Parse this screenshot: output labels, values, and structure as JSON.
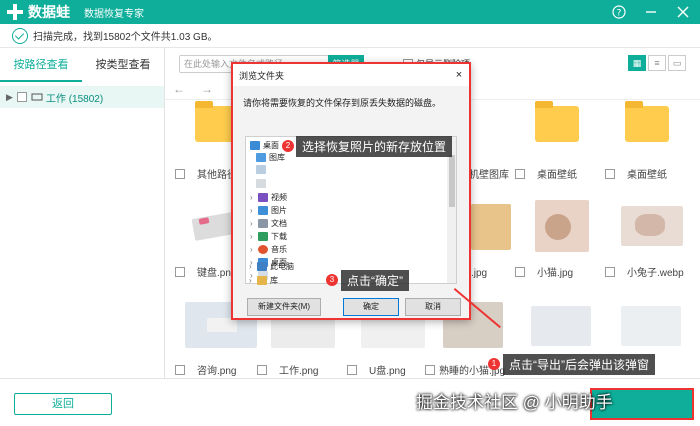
{
  "app": {
    "name": "数据蛙",
    "subtitle": "数据恢复专家"
  },
  "status": {
    "text": "扫描完成，找到15802个文件共1.03 GB。"
  },
  "sidebar": {
    "tabs": [
      {
        "label": "按路径查看"
      },
      {
        "label": "按类型查看"
      }
    ],
    "tree": [
      {
        "label": "工作 (15802)"
      }
    ]
  },
  "toolbar": {
    "search_placeholder": "在此处输入文件名或路径",
    "filter_label": "筛选器",
    "only_deleted_label": "仅显示删除项"
  },
  "files": [
    {
      "name": "其他路径",
      "kind": "folder"
    },
    {
      "name": "",
      "kind": "folder"
    },
    {
      "name": "",
      "kind": "folder"
    },
    {
      "name": "手机壁图库",
      "kind": "folder"
    },
    {
      "name": "桌面壁纸",
      "kind": "folder"
    },
    {
      "name": "桌面壁纸",
      "kind": "folder"
    },
    {
      "name": "键盘.png",
      "kind": "image"
    },
    {
      "name": "",
      "kind": "image"
    },
    {
      "name": "",
      "kind": "image"
    },
    {
      "name": "天.jpg",
      "kind": "image"
    },
    {
      "name": "小猫.jpg",
      "kind": "image"
    },
    {
      "name": "小兔子.webp",
      "kind": "image"
    },
    {
      "name": "咨询.png",
      "kind": "image"
    },
    {
      "name": "工作.png",
      "kind": "image"
    },
    {
      "name": "U盘.png",
      "kind": "image"
    },
    {
      "name": "熟睡的小猫.jpg",
      "kind": "image"
    },
    {
      "name": "",
      "kind": "image"
    },
    {
      "name": "",
      "kind": "image"
    }
  ],
  "footer": {
    "back_label": "返回"
  },
  "dialog": {
    "title": "浏览文件夹",
    "close": "×",
    "message": "请你将需要恢复的文件保存到原丢失数据的磁盘。",
    "tree": [
      {
        "label": "桌面",
        "level": 0
      },
      {
        "label": "图库",
        "level": 1
      },
      {
        "label": "",
        "level": 1
      },
      {
        "label": "",
        "level": 1
      },
      {
        "label": "视频",
        "level": 1
      },
      {
        "label": "图片",
        "level": 1
      },
      {
        "label": "文档",
        "level": 1
      },
      {
        "label": "下载",
        "level": 1
      },
      {
        "label": "音乐",
        "level": 1
      },
      {
        "label": "桌面",
        "level": 1
      },
      {
        "label": "",
        "level": 1
      },
      {
        "label": "此电脑",
        "level": 1
      },
      {
        "label": "库",
        "level": 1
      }
    ],
    "new_folder_label": "新建文件夹(M)",
    "ok_label": "确定",
    "cancel_label": "取消"
  },
  "annotations": {
    "step1": {
      "num": "1",
      "text": "点击“导出”后会弹出该弹窗"
    },
    "step2": {
      "num": "2",
      "text": "选择恢复照片的新存放位置"
    },
    "step3": {
      "num": "3",
      "text": "点击“确定”"
    }
  },
  "watermark": "掘金技术社区 @ 小明助手",
  "colors": {
    "accent": "#0fae9a",
    "highlight": "#e33333"
  }
}
